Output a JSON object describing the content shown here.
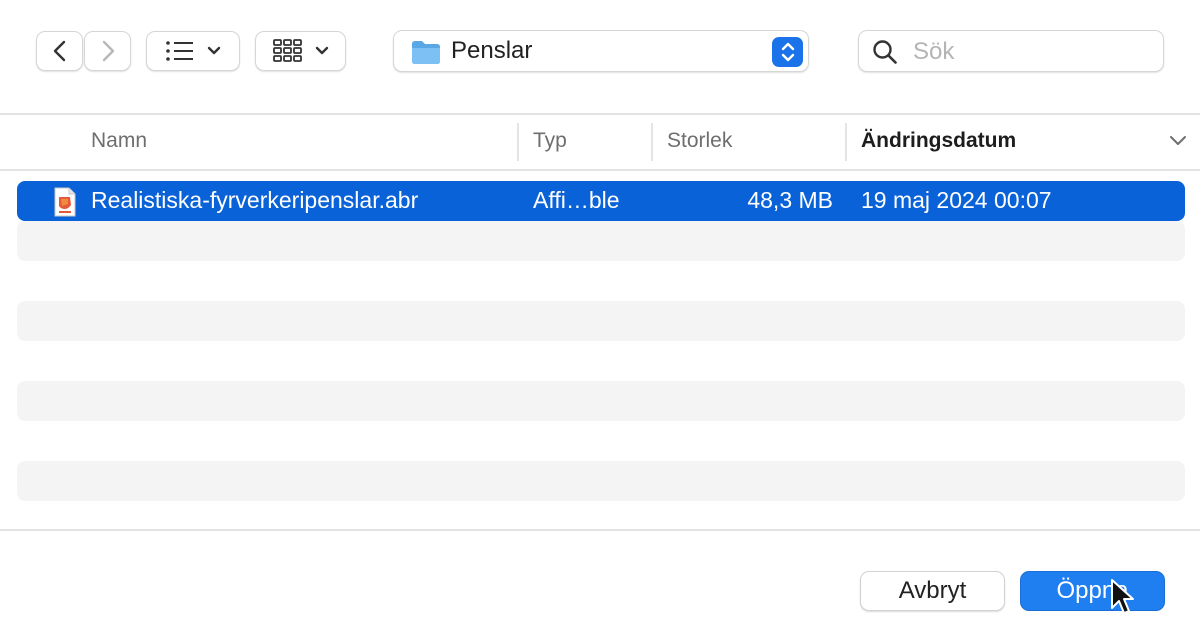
{
  "toolbar": {
    "back_icon": "chevron-left-icon",
    "forward_icon": "chevron-right-icon",
    "list_view_icon": "list-view-icon",
    "grid_view_icon": "grid-view-icon",
    "path": {
      "label": "Penslar",
      "icon": "folder-icon"
    },
    "search": {
      "placeholder": "Sök",
      "value": ""
    }
  },
  "columns": {
    "name": "Namn",
    "type": "Typ",
    "size": "Storlek",
    "modified": "Ändringsdatum",
    "sorted_by": "modified"
  },
  "files": [
    {
      "name": "Realistiska-fyrverkeripenslar.abr",
      "type": "Affi…ble",
      "size": "48,3 MB",
      "modified": "19 maj 2024 00:07",
      "selected": true
    }
  ],
  "actions": {
    "cancel_label": "Avbryt",
    "open_label": "Öppna"
  },
  "colors": {
    "accent": "#1f7ff0",
    "selection": "#0a62d8",
    "stripe": "#f4f4f4"
  }
}
